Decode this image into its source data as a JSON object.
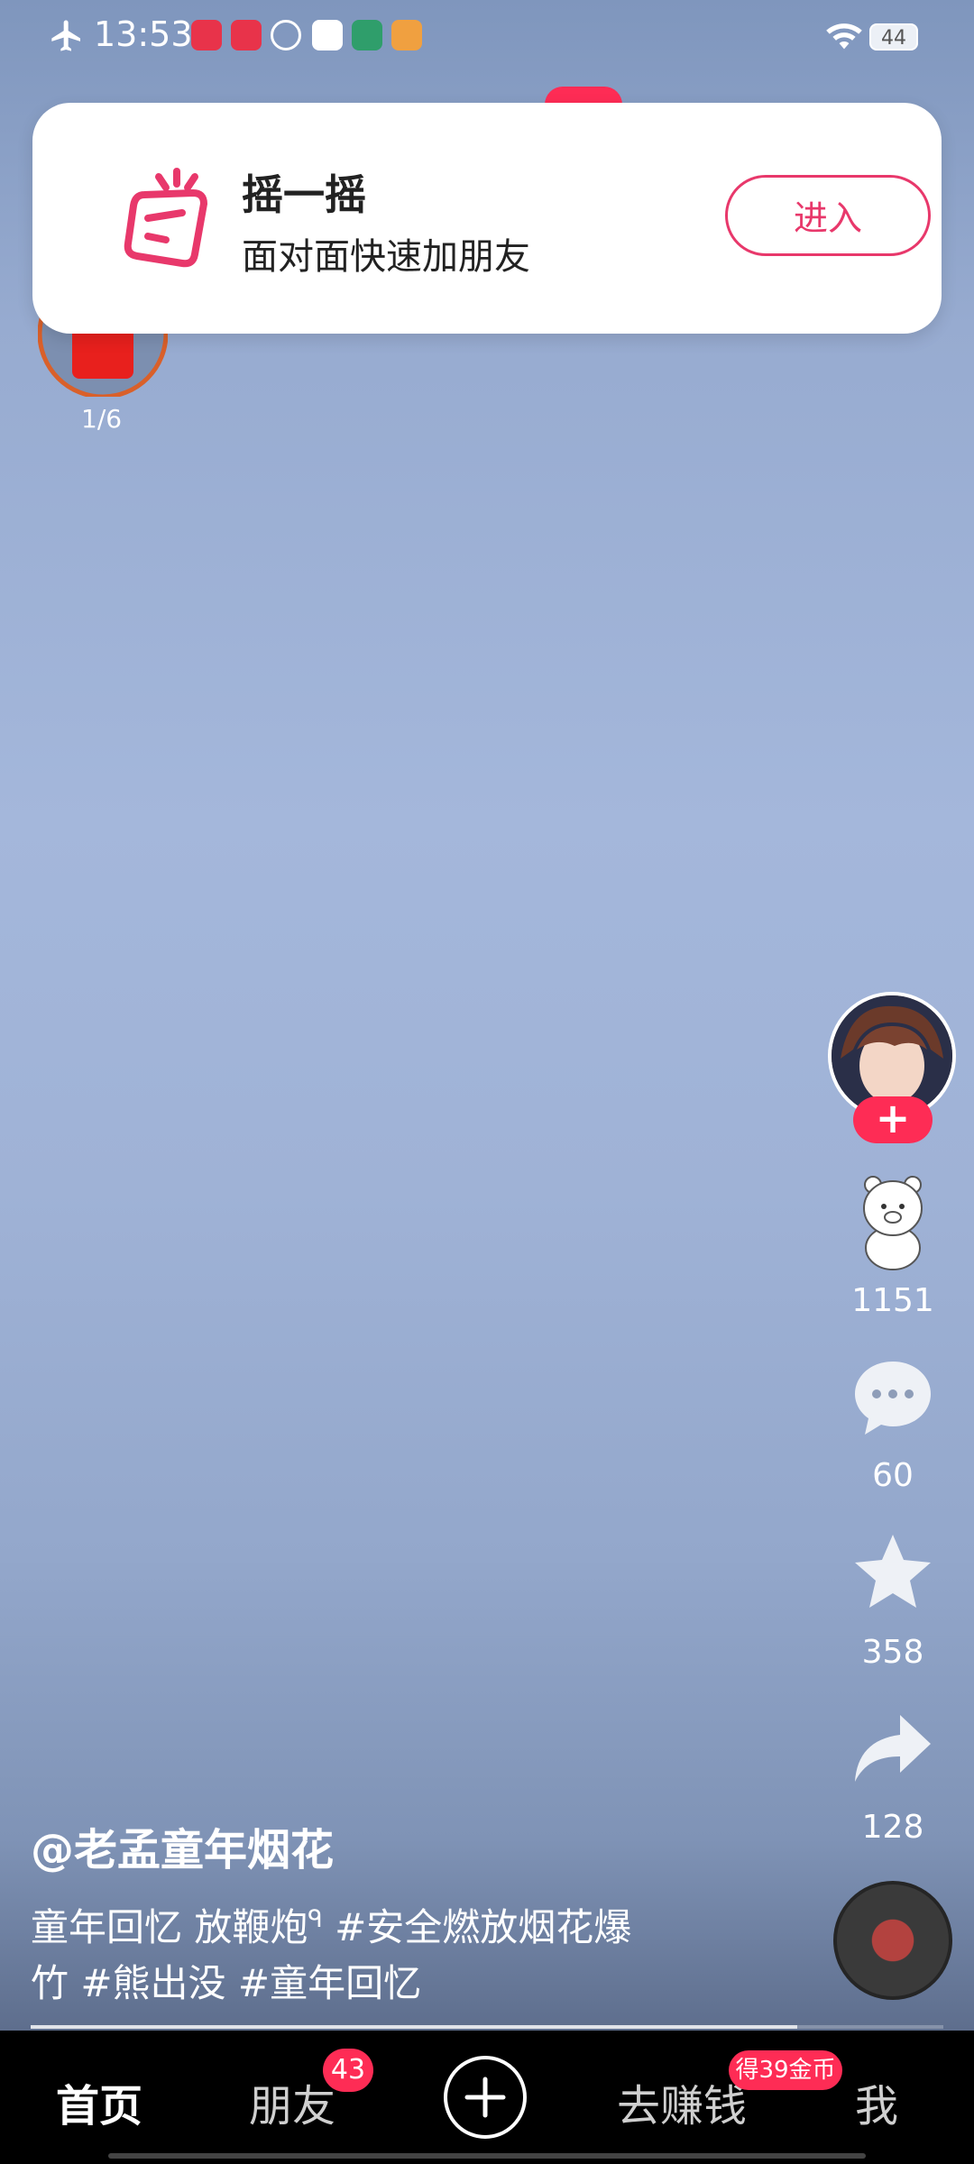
{
  "status_bar": {
    "time": "13:53",
    "battery": "44",
    "icons": [
      "airplane-mode-icon",
      "app-icon-1",
      "app-icon-2",
      "app-icon-3",
      "app-icon-4",
      "app-icon-5",
      "app-icon-6",
      "wifi-icon",
      "battery-icon"
    ]
  },
  "notification": {
    "title": "摇一摇",
    "subtitle": "面对面快速加朋友",
    "action_label": "进入",
    "accent_color": "#e8386b",
    "icon": "shake-phone-icon"
  },
  "red_packet": {
    "count": "1/6",
    "icon": "red-packet-icon"
  },
  "right_rail": {
    "follow_label": "+",
    "likes": "1151",
    "comments": "60",
    "favorites": "358",
    "shares": "128",
    "icons": [
      "avatar",
      "bear-like-icon",
      "comment-icon",
      "star-icon",
      "share-icon",
      "music-disc-icon"
    ]
  },
  "caption": {
    "author": "@老孟童年烟花",
    "description_text_1": "童年回忆 放鞭炮",
    "search_glyph": "ᑫ",
    "hashtag_1": "#安全燃放烟花爆",
    "description_line_2": "竹 #熊出没 #童年回忆"
  },
  "progress": {
    "fraction": 0.84
  },
  "bottom_nav": {
    "home": "首页",
    "friends": "朋友",
    "friends_badge": "43",
    "create_label": "+",
    "earn": "去赚钱",
    "earn_badge": "得39金币",
    "me": "我"
  },
  "colors": {
    "accent_red": "#fe2c55",
    "nav_bg": "#000000"
  }
}
